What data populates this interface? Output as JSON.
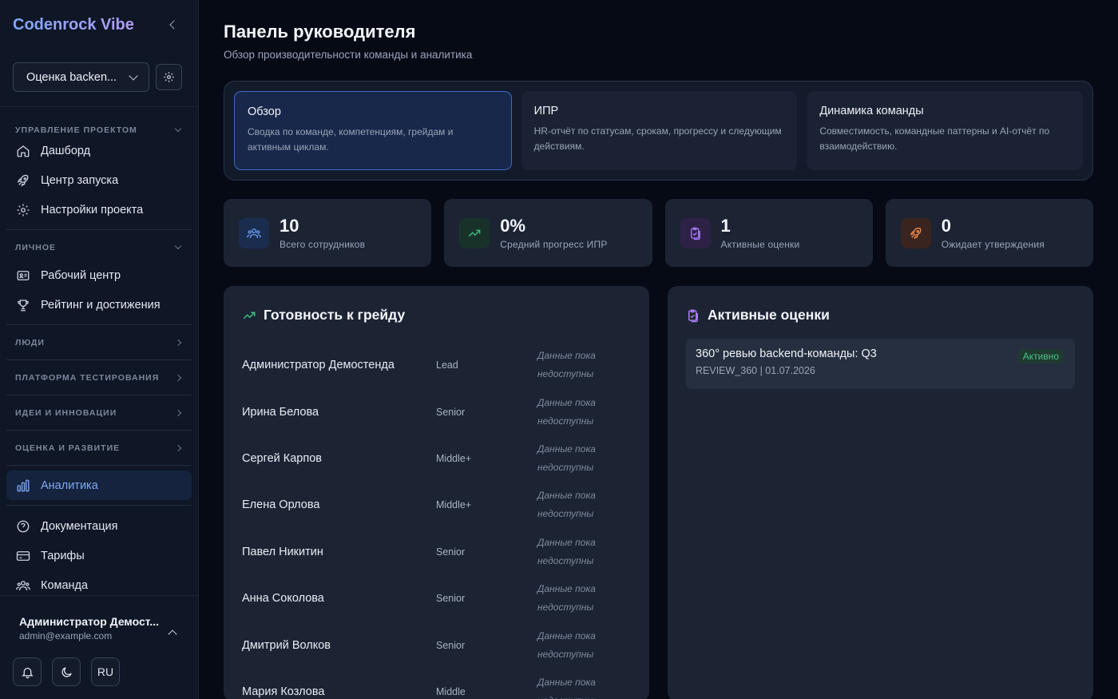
{
  "app": {
    "logo": "Codenrock Vibe"
  },
  "project": {
    "selected": "Оценка backen..."
  },
  "sidebar": {
    "sections": [
      {
        "title": "УПРАВЛЕНИЕ ПРОЕКТОМ",
        "items": [
          "Дашборд",
          "Центр запуска",
          "Настройки проекта"
        ]
      },
      {
        "title": "ЛИЧНОЕ",
        "items": [
          "Рабочий центр",
          "Рейтинг и достижения"
        ]
      }
    ],
    "collapsed_sections": [
      "ЛЮДИ",
      "ПЛАТФОРМА ТЕСТИРОВАНИЯ",
      "ИДЕИ И ИННОВАЦИИ",
      "ОЦЕНКА И РАЗВИТИЕ"
    ],
    "active_item": "Аналитика",
    "footer_items": [
      "Документация",
      "Тарифы",
      "Команда"
    ]
  },
  "user": {
    "name": "Администратор Демост...",
    "email": "admin@example.com"
  },
  "controls": {
    "lang": "RU"
  },
  "header": {
    "title": "Панель руководителя",
    "subtitle": "Обзор производительности команды и аналитика"
  },
  "tabs": [
    {
      "title": "Обзор",
      "desc": "Сводка по команде, компетенциям, грейдам и активным циклам."
    },
    {
      "title": "ИПР",
      "desc": "HR-отчёт по статусам, срокам, прогрессу и следующим действиям."
    },
    {
      "title": "Динамика команды",
      "desc": "Совместимость, командные паттерны и AI-отчёт по взаимодействию."
    }
  ],
  "stats": [
    {
      "value": "10",
      "label": "Всего сотрудников"
    },
    {
      "value": "0%",
      "label": "Средний прогресс ИПР"
    },
    {
      "value": "1",
      "label": "Активные оценки"
    },
    {
      "value": "0",
      "label": "Ожидает утверждения"
    }
  ],
  "readiness": {
    "title": "Готовность к грейду",
    "rows": [
      {
        "name": "Администратор Демостенда",
        "level": "Lead",
        "status": "Данные пока недоступны"
      },
      {
        "name": "Ирина Белова",
        "level": "Senior",
        "status": "Данные пока недоступны"
      },
      {
        "name": "Сергей Карпов",
        "level": "Middle+",
        "status": "Данные пока недоступны"
      },
      {
        "name": "Елена Орлова",
        "level": "Middle+",
        "status": "Данные пока недоступны"
      },
      {
        "name": "Павел Никитин",
        "level": "Senior",
        "status": "Данные пока недоступны"
      },
      {
        "name": "Анна Соколова",
        "level": "Senior",
        "status": "Данные пока недоступны"
      },
      {
        "name": "Дмитрий Волков",
        "level": "Senior",
        "status": "Данные пока недоступны"
      },
      {
        "name": "Мария Козлова",
        "level": "Middle",
        "status": "Данные пока недоступны"
      }
    ]
  },
  "active_evals": {
    "title": "Активные оценки",
    "items": [
      {
        "title": "360° ревью backend-команды: Q3",
        "meta": "REVIEW_360 | 01.07.2026",
        "status": "Активно"
      }
    ]
  },
  "colors": {
    "accent": "#3d6ac8",
    "active_nav": "#7fa8f3",
    "badge_green": "#4cc38a"
  }
}
